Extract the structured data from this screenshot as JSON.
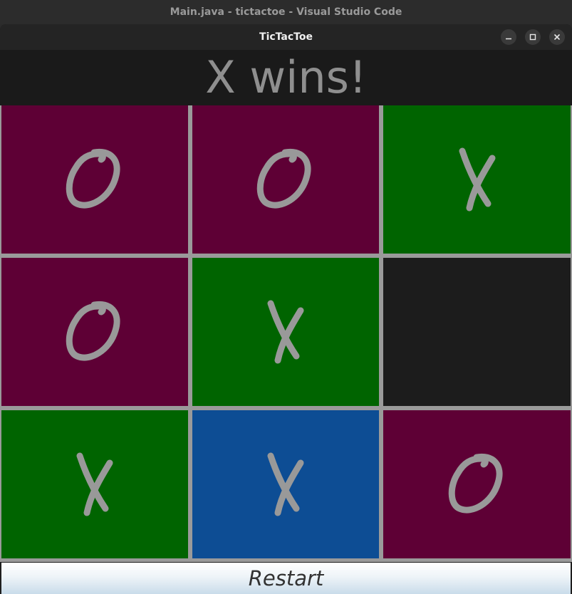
{
  "os_title": "Main.java - tictactoe - Visual Studio Code",
  "window": {
    "title": "TicTacToe",
    "controls": [
      "minimize-icon",
      "maximize-icon",
      "close-icon"
    ]
  },
  "status": "X wins!",
  "restart_label": "Restart",
  "colors": {
    "o_cell": "#5e0035",
    "x_cell": "#006400",
    "empty_cell": "#1c1c1c",
    "highlight_cell": "#0d4d94",
    "mark": "#999999",
    "grid": "#9a9a9a"
  },
  "board": [
    [
      "O",
      "O",
      "X"
    ],
    [
      "O",
      "X",
      ""
    ],
    [
      "X",
      "X",
      "O"
    ]
  ],
  "highlighted_cells": [
    [
      2,
      1
    ]
  ]
}
